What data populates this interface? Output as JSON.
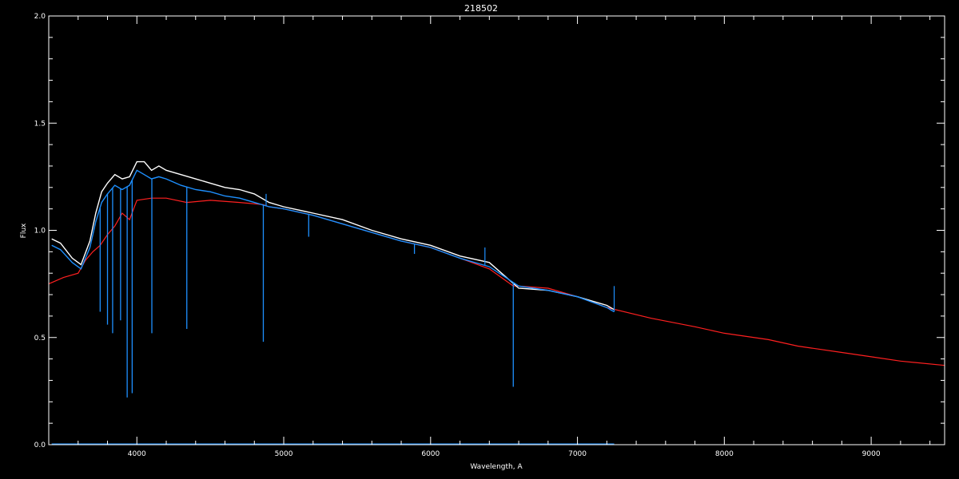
{
  "chart_data": {
    "type": "line",
    "title": "218502",
    "xlabel": "Wavelength, A",
    "ylabel": "Flux",
    "xlim": [
      3400,
      9500
    ],
    "ylim": [
      0.0,
      2.0
    ],
    "x_ticks": [
      4000,
      5000,
      6000,
      7000,
      8000,
      9000
    ],
    "y_ticks": [
      0.0,
      0.5,
      1.0,
      1.5,
      2.0
    ],
    "y_tick_labels": [
      "0.0",
      "0.5",
      "1.0",
      "1.5",
      "2.0"
    ],
    "grid": false,
    "background": "#000000",
    "series": [
      {
        "key": "observed_upper",
        "color": "#ffffff",
        "x": [
          3420,
          3480,
          3560,
          3620,
          3680,
          3720,
          3760,
          3800,
          3850,
          3900,
          3950,
          4000,
          4050,
          4100,
          4150,
          4200,
          4300,
          4400,
          4500,
          4600,
          4700,
          4800,
          4900,
          5000,
          5200,
          5400,
          5600,
          5800,
          6000,
          6200,
          6400,
          6600,
          6800,
          7000,
          7200,
          7250
        ],
        "y": [
          0.96,
          0.94,
          0.87,
          0.84,
          0.95,
          1.08,
          1.18,
          1.22,
          1.26,
          1.24,
          1.25,
          1.32,
          1.32,
          1.28,
          1.3,
          1.28,
          1.26,
          1.24,
          1.22,
          1.2,
          1.19,
          1.17,
          1.13,
          1.11,
          1.08,
          1.05,
          1.0,
          0.96,
          0.93,
          0.88,
          0.85,
          0.73,
          0.72,
          0.69,
          0.65,
          0.63
        ]
      },
      {
        "key": "observed",
        "color": "#1e90ff",
        "x": [
          3420,
          3480,
          3560,
          3620,
          3680,
          3720,
          3760,
          3800,
          3850,
          3900,
          3950,
          4000,
          4050,
          4100,
          4150,
          4200,
          4300,
          4400,
          4500,
          4600,
          4700,
          4800,
          4900,
          5000,
          5200,
          5400,
          5600,
          5800,
          6000,
          6200,
          6400,
          6600,
          6800,
          7000,
          7200,
          7250
        ],
        "y": [
          0.93,
          0.91,
          0.85,
          0.82,
          0.92,
          1.04,
          1.13,
          1.17,
          1.21,
          1.19,
          1.21,
          1.28,
          1.26,
          1.24,
          1.25,
          1.24,
          1.21,
          1.19,
          1.18,
          1.16,
          1.15,
          1.13,
          1.11,
          1.1,
          1.07,
          1.03,
          0.99,
          0.95,
          0.92,
          0.87,
          0.83,
          0.74,
          0.72,
          0.69,
          0.64,
          0.62
        ]
      },
      {
        "key": "model",
        "color": "#ff2020",
        "x": [
          3400,
          3500,
          3600,
          3650,
          3700,
          3750,
          3800,
          3850,
          3900,
          3950,
          4000,
          4100,
          4200,
          4340,
          4500,
          4700,
          4861,
          4900,
          5000,
          5200,
          5400,
          5600,
          5800,
          6000,
          6200,
          6400,
          6563,
          6600,
          6800,
          7000,
          7200,
          7500,
          7800,
          8000,
          8300,
          8500,
          8800,
          9000,
          9200,
          9500
        ],
        "y": [
          0.75,
          0.78,
          0.8,
          0.86,
          0.9,
          0.93,
          0.98,
          1.02,
          1.08,
          1.05,
          1.14,
          1.15,
          1.15,
          1.13,
          1.14,
          1.13,
          1.12,
          1.11,
          1.1,
          1.07,
          1.03,
          0.99,
          0.95,
          0.92,
          0.87,
          0.82,
          0.74,
          0.74,
          0.73,
          0.69,
          0.64,
          0.59,
          0.55,
          0.52,
          0.49,
          0.46,
          0.43,
          0.41,
          0.39,
          0.37
        ]
      },
      {
        "key": "noise",
        "color": "#1e90ff",
        "x": [
          3420,
          7250
        ],
        "y": [
          0.003,
          0.003
        ]
      }
    ],
    "absorption_lines": [
      {
        "x": 3750,
        "depth_to": 0.62
      },
      {
        "x": 3800,
        "depth_to": 0.56
      },
      {
        "x": 3835,
        "depth_to": 0.52
      },
      {
        "x": 3889,
        "depth_to": 0.58
      },
      {
        "x": 3934,
        "depth_to": 0.22
      },
      {
        "x": 3968,
        "depth_to": 0.24
      },
      {
        "x": 4102,
        "depth_to": 0.52
      },
      {
        "x": 4340,
        "depth_to": 0.54
      },
      {
        "x": 4861,
        "depth_to": 0.48
      },
      {
        "x": 5170,
        "depth_to": 0.97
      },
      {
        "x": 5890,
        "depth_to": 0.89
      },
      {
        "x": 6563,
        "depth_to": 0.27
      }
    ],
    "emission_spikes": [
      {
        "x": 4880,
        "peak": 1.17
      },
      {
        "x": 6370,
        "peak": 0.92
      },
      {
        "x": 7250,
        "peak": 0.74
      }
    ]
  }
}
